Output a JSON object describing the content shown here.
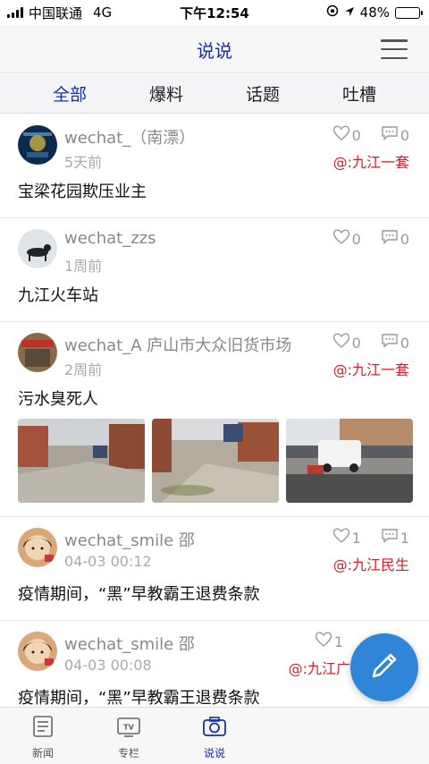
{
  "status_bar": {
    "carrier": "中国联通",
    "network": "4G",
    "time": "下午12:54",
    "battery": "48%",
    "battery_level": 0.48
  },
  "header": {
    "title": "说说"
  },
  "tabs": [
    {
      "label": "全部",
      "active": true
    },
    {
      "label": "爆料",
      "active": false
    },
    {
      "label": "话题",
      "active": false
    },
    {
      "label": "吐槽",
      "active": false
    }
  ],
  "posts": [
    {
      "user": "wechat_（南漂）",
      "time": "5天前",
      "likes": "0",
      "comments": "0",
      "tag": "@:九江一套",
      "text": "宝梁花园欺压业主"
    },
    {
      "user": "wechat_zzs",
      "time": "1周前",
      "likes": "0",
      "comments": "0",
      "tag": "",
      "text": "九江火车站"
    },
    {
      "user": "wechat_A 庐山市大众旧货市场",
      "time": "2周前",
      "likes": "0",
      "comments": "0",
      "tag": "@:九江一套",
      "text": "污水臭死人"
    },
    {
      "user": "wechat_smile 邵",
      "time": "04-03 00:12",
      "likes": "1",
      "comments": "1",
      "tag": "@:九江民生",
      "text": "疫情期间，“黑”早教霸王退费条款"
    },
    {
      "user": "wechat_smile 邵",
      "time": "04-03 00:08",
      "likes": "1",
      "comments": "",
      "tag": "@:九江广",
      "text": "疫情期间，“黑”早教霸王退费条款"
    }
  ],
  "bottom_nav": [
    {
      "label": "新闻",
      "icon": "news-icon",
      "active": false
    },
    {
      "label": "专栏",
      "icon": "tv-icon",
      "active": false
    },
    {
      "label": "说说",
      "icon": "camera-icon",
      "active": true
    }
  ],
  "colors": {
    "accent": "#1a2fa0",
    "tag": "#d0202c",
    "fab": "#2f86d8"
  }
}
